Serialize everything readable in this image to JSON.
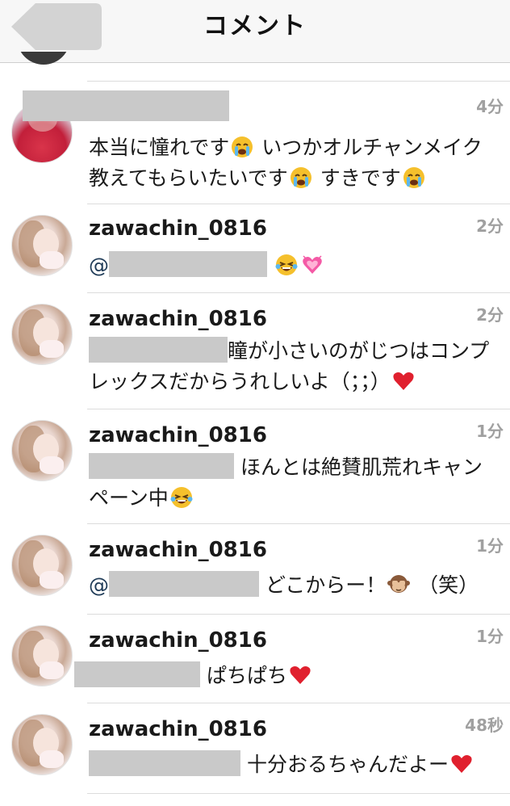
{
  "header": {
    "title": "コメント"
  },
  "comments": [
    {
      "username": "",
      "time": "4分",
      "text_a": "本当に憧れです",
      "text_b": " いつかオルチャンメイク教えてもらいたいです",
      "text_c": " すきです"
    },
    {
      "username": "zawachin_0816",
      "time": "2分",
      "mention": "@"
    },
    {
      "username": "zawachin_0816",
      "time": "2分",
      "text": "瞳が小さいのがじつはコンプレックスだからうれしいよ（；；）"
    },
    {
      "username": "zawachin_0816",
      "time": "1分",
      "text": " ほんとは絶賛肌荒れキャンペーン中"
    },
    {
      "username": "zawachin_0816",
      "time": "1分",
      "mention": "@",
      "text_a": " どこからー！",
      "text_b": " （笑）"
    },
    {
      "username": "zawachin_0816",
      "time": "1分",
      "text": "ぱちぱち"
    },
    {
      "username": "zawachin_0816",
      "time": "48秒",
      "text": " 十分おるちゃんだよー"
    }
  ]
}
